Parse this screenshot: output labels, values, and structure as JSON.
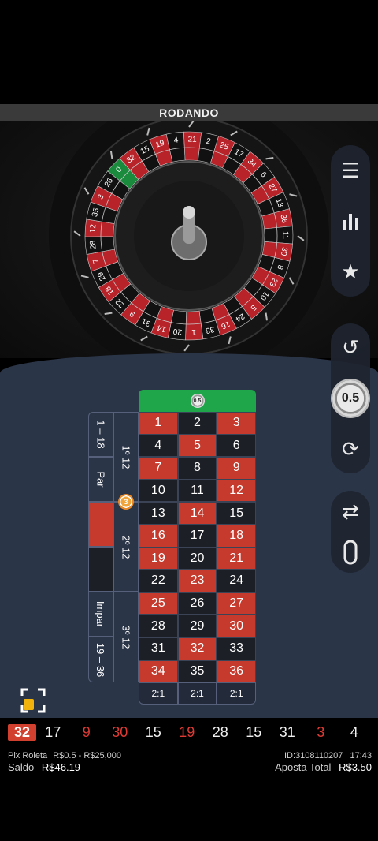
{
  "status": {
    "title": "RODANDO"
  },
  "wheel": {
    "sequence": [
      "0",
      "32",
      "15",
      "19",
      "4",
      "21",
      "2",
      "25",
      "17",
      "34",
      "6",
      "27",
      "13",
      "36",
      "11",
      "30",
      "8",
      "23",
      "10",
      "5",
      "24",
      "16",
      "33",
      "1",
      "20",
      "14",
      "31",
      "9",
      "22",
      "18",
      "29",
      "7",
      "28",
      "12",
      "35",
      "3",
      "26"
    ],
    "red_numbers": [
      "1",
      "3",
      "5",
      "7",
      "9",
      "12",
      "14",
      "16",
      "18",
      "19",
      "21",
      "23",
      "25",
      "27",
      "30",
      "32",
      "34",
      "36"
    ]
  },
  "side": {
    "menu_icon": "menu-icon",
    "stats_icon": "stats-icon",
    "favorites_icon": "favorites-icon",
    "undo_icon": "undo-icon",
    "chip_value": "0.5",
    "repeat_icon": "repeat-icon",
    "autoplay_icon": "autoplay-icon",
    "racetrack_icon": "racetrack-icon"
  },
  "board": {
    "zero_chip": "0.5",
    "rows": [
      [
        "1",
        "2",
        "3"
      ],
      [
        "4",
        "5",
        "6"
      ],
      [
        "7",
        "8",
        "9"
      ],
      [
        "10",
        "11",
        "12"
      ],
      [
        "13",
        "14",
        "15"
      ],
      [
        "16",
        "17",
        "18"
      ],
      [
        "19",
        "20",
        "21"
      ],
      [
        "22",
        "23",
        "24"
      ],
      [
        "25",
        "26",
        "27"
      ],
      [
        "28",
        "29",
        "30"
      ],
      [
        "31",
        "32",
        "33"
      ],
      [
        "34",
        "35",
        "36"
      ]
    ],
    "columns": [
      "2:1",
      "2:1",
      "2:1"
    ],
    "outside": {
      "low": "1 – 18",
      "even": "Par",
      "odd": "Impar",
      "high": "19 – 36"
    },
    "dozens": [
      "1º 12",
      "2º 12",
      "3º 12"
    ],
    "dozen_chip": "3"
  },
  "history": [
    {
      "n": "32",
      "c": "first"
    },
    {
      "n": "17",
      "c": "white"
    },
    {
      "n": "9",
      "c": "red"
    },
    {
      "n": "30",
      "c": "red"
    },
    {
      "n": "15",
      "c": "white"
    },
    {
      "n": "19",
      "c": "red"
    },
    {
      "n": "28",
      "c": "white"
    },
    {
      "n": "15",
      "c": "white"
    },
    {
      "n": "31",
      "c": "white"
    },
    {
      "n": "3",
      "c": "red"
    },
    {
      "n": "4",
      "c": "white"
    }
  ],
  "footer": {
    "game_name": "Pix Roleta",
    "limits": "R$0.5 - R$25,000",
    "balance_label": "Saldo",
    "balance_value": "R$46.19",
    "round_id": "ID:3108110207",
    "time": "17:43",
    "total_bet_label": "Aposta Total",
    "total_bet_value": "R$3.50"
  },
  "colors": {
    "red": "#c53a2c",
    "black": "#1c1f26",
    "green": "#1fa64a",
    "table_bg": "#2b3548"
  }
}
